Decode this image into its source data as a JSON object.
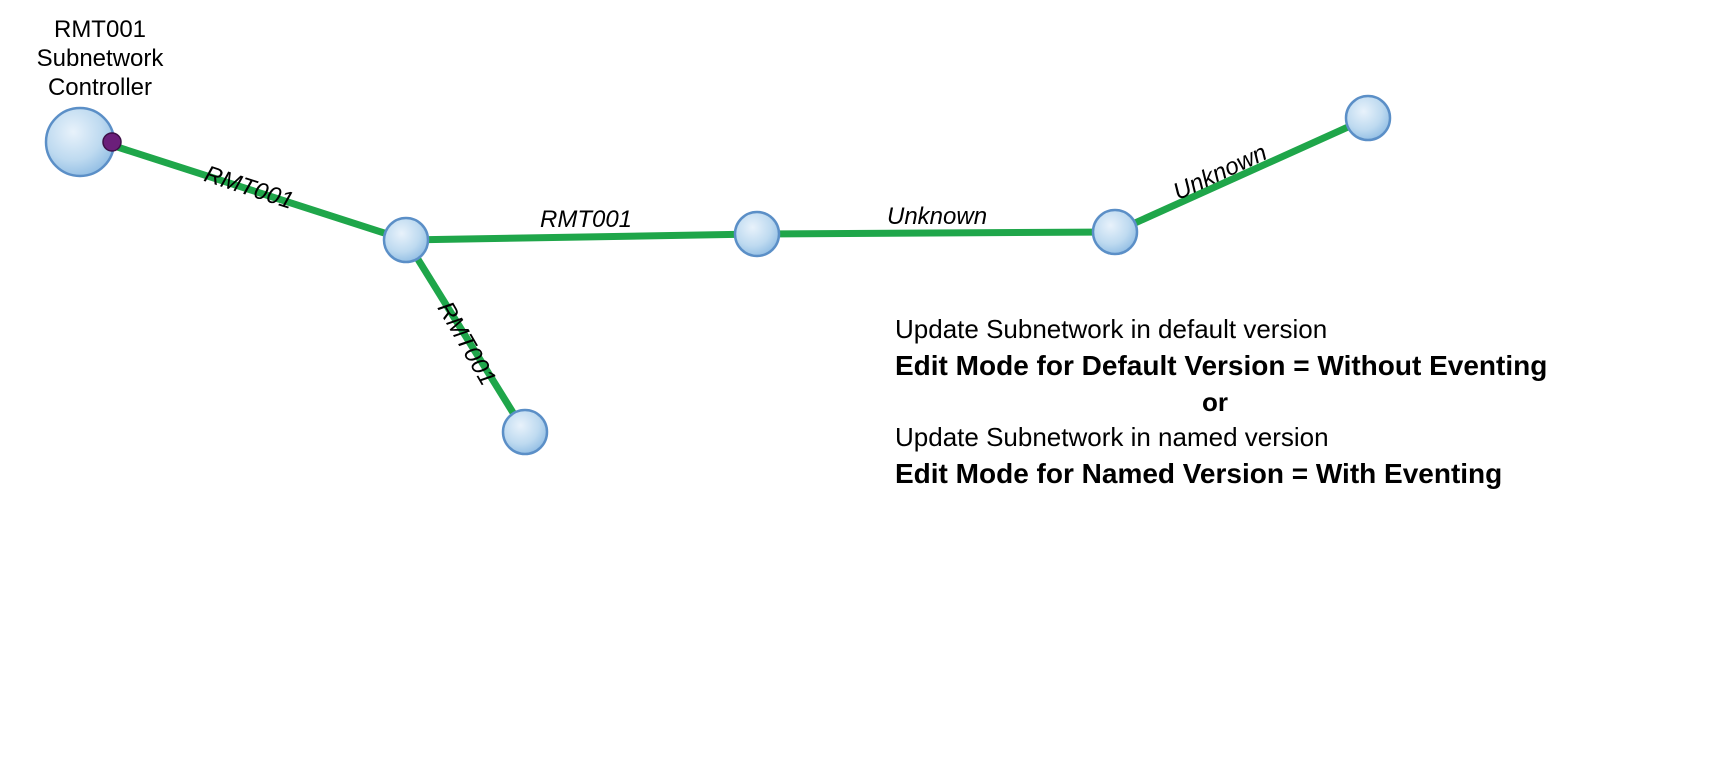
{
  "controller_label_line1": "RMT001",
  "controller_label_line2": "Subnetwork",
  "controller_label_line3": "Controller",
  "edges": {
    "e1": "RMT001",
    "e2": "RMT001",
    "e3": "RMT001",
    "e4": "Unknown",
    "e5": "Unknown"
  },
  "info": {
    "line1": "Update Subnetwork in default version",
    "line2": "Edit Mode for Default Version = Without Eventing",
    "or": "or",
    "line3": "Update Subnetwork in named version",
    "line4": "Edit Mode for Named Version = With Eventing"
  },
  "colors": {
    "edge": "#1fa64a",
    "node_fill_top": "#d3e6f7",
    "node_fill_bottom": "#9ec8eb",
    "node_stroke": "#5b8fc7",
    "controller_dot": "#6b1f7a"
  }
}
